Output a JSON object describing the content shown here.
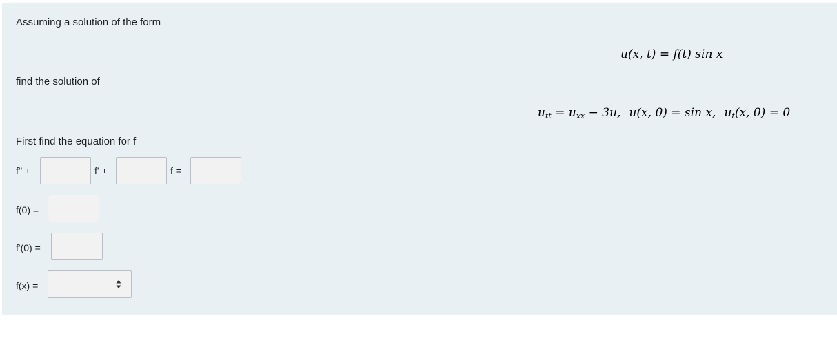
{
  "intro_text": "Assuming a solution of the form",
  "find_text": "find the solution of",
  "first_find_text": "First find the equation for f",
  "eq_form": {
    "lhs": "u(x, t)",
    "eq": "=",
    "rhs": "f(t) sin x"
  },
  "pde": {
    "part1": "u",
    "part1_sub": "tt",
    "part2": " = u",
    "part2_sub": "xx",
    "part3": " − 3u,",
    "ic1": "u(x, 0) = sin x,",
    "ic2_u": "u",
    "ic2_sub": "t",
    "ic2_rest": "(x, 0) = 0"
  },
  "ode_row": {
    "label_fpp": "f'' +",
    "label_fp": "f' +",
    "label_f": "f =",
    "input1_value": "",
    "input2_value": "",
    "input3_value": ""
  },
  "f0_row": {
    "label": "f(0) =",
    "value": ""
  },
  "fp0_row": {
    "label": "f'(0) =",
    "value": ""
  },
  "fx_row": {
    "label": "f(x) =",
    "selected": ""
  },
  "icons": {
    "select_arrows": "up-down-arrows-icon"
  }
}
